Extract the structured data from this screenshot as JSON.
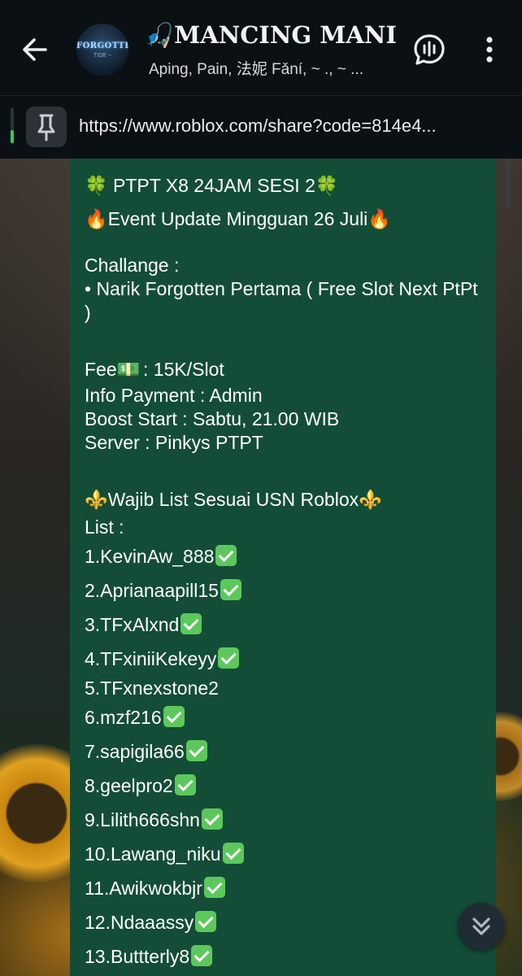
{
  "header": {
    "title": "🎣MANCING MANI...",
    "subtitle": "Aping, Pain, 法妮 Fǎní, ~ ., ~ ...",
    "avatar_text": "FORGOTTEN",
    "avatar_subtext": "TIDE ~",
    "icons": {
      "back": "arrow-left-icon",
      "voice": "voice-chat-icon",
      "menu": "more-vertical-icon"
    }
  },
  "pinned": {
    "url": "https://www.roblox.com/share?code=814e4...",
    "icon": "pin-icon"
  },
  "message": {
    "title_line": "🍀 PTPT X8 24JAM SESI 2🍀",
    "event_line": "🔥Event Update Mingguan 26 Juli🔥",
    "challenge_label": "Challange :",
    "challenge_item": "• Narik Forgotten Pertama ( Free Slot Next PtPt )",
    "fee_prefix": "Fee",
    "fee_emoji": "💵",
    "fee_value": " : 15K/Slot",
    "info_payment": "Info Payment : Admin",
    "boost_start": "Boost Start : Sabtu, 21.00 WIB",
    "server": "Server : Pinkys PTPT",
    "wajib_line": "⚜️Wajib List Sesuai USN Roblox⚜️",
    "list_label": "List :",
    "list": [
      {
        "text": "1.KevinAw_888",
        "checked": true
      },
      {
        "text": "2.Aprianaapill15",
        "checked": true
      },
      {
        "text": "3.TFxAlxnd",
        "checked": true
      },
      {
        "text": "4.TFxiniiKekeyy",
        "checked": true
      },
      {
        "text": "5.TFxnexstone2",
        "checked": false
      },
      {
        "text": "6.mzf216",
        "checked": true
      },
      {
        "text": "7.sapigila66",
        "checked": true
      },
      {
        "text": "8.geelpro2",
        "checked": true
      },
      {
        "text": "9.Lilith666shn",
        "checked": true
      },
      {
        "text": "10.Lawang_niku",
        "checked": true
      },
      {
        "text": "11.Awikwokbjr",
        "checked": true
      },
      {
        "text": "12.Ndaaassy",
        "checked": true
      },
      {
        "text": "13.Buttterly8",
        "checked": true
      }
    ]
  },
  "colors": {
    "header_bg": "#0b1014",
    "bubble_bg": "#144d37",
    "accent_green": "#25d366",
    "check_green": "#5cc85c"
  },
  "scroll_down_icon": "double-chevron-down-icon"
}
